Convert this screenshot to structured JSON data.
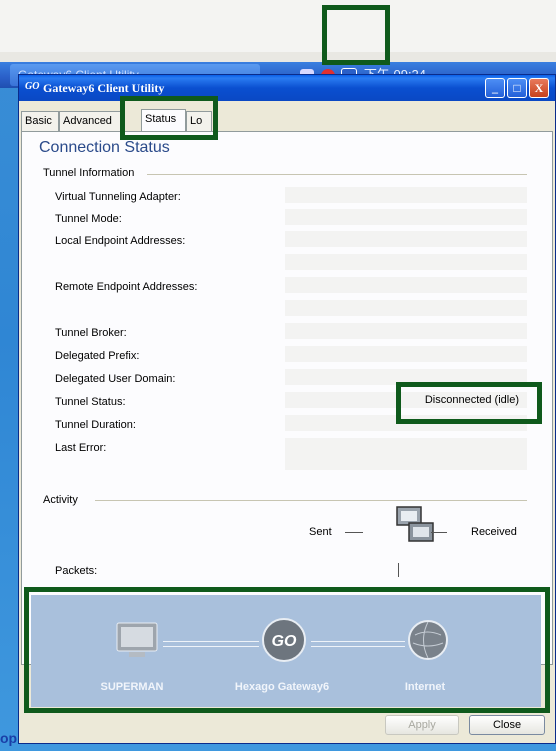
{
  "background": {
    "taskbar_button": "Gateway6 Client Utility",
    "tray_text": "下午 09:24",
    "side_text": "op"
  },
  "window": {
    "logo": "GO",
    "title": "Gateway6 Client Utility",
    "controls": [
      "_",
      "□",
      "X"
    ],
    "tabs": [
      "Basic",
      "Advanced",
      "Status",
      "Lo"
    ],
    "active_tab": "Status",
    "heading": "Connection Status",
    "tunnel_group": "Tunnel Information",
    "fields": [
      {
        "label": "Virtual Tunneling Adapter:",
        "value": ""
      },
      {
        "label": "Tunnel Mode:",
        "value": ""
      },
      {
        "label": "Local Endpoint Addresses:",
        "value": ""
      },
      {
        "label": "Remote Endpoint Addresses:",
        "value": ""
      },
      {
        "label": "Tunnel Broker:",
        "value": ""
      },
      {
        "label": "Delegated Prefix:",
        "value": ""
      },
      {
        "label": "Delegated User Domain:",
        "value": ""
      },
      {
        "label": "Tunnel Status:",
        "value": "Disconnected (idle)"
      },
      {
        "label": "Tunnel Duration:",
        "value": ""
      },
      {
        "label": "Last Error:",
        "value": ""
      }
    ],
    "activity_group": "Activity",
    "sent": "Sent",
    "received": "Received",
    "packets": "Packets:",
    "banner": {
      "left": "SUPERMAN",
      "middle": "Hexago Gateway6",
      "right": "Internet",
      "middle_logo": "GO"
    },
    "buttons": {
      "apply": "Apply",
      "close": "Close"
    }
  },
  "colors": {
    "highlight": "#0f5a1c",
    "heading": "#2a4a8a",
    "banner": "#a9c0dc"
  }
}
